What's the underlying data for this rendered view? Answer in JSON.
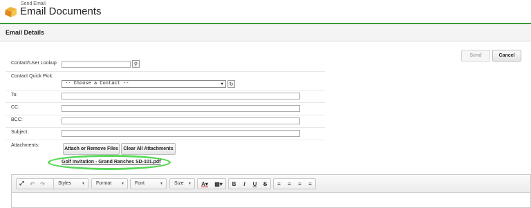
{
  "header": {
    "breadcrumb": "Send Email",
    "title": "Email Documents"
  },
  "section": {
    "title": "Email Details"
  },
  "actions": {
    "send_label": "Send",
    "cancel_label": "Cancel"
  },
  "form": {
    "lookup_label": "Contact/User Lookup",
    "quickpick_label": "Contact Quick Pick:",
    "quickpick_selected": "-- Choose a Contact --",
    "to_label": "To:",
    "cc_label": "CC:",
    "bcc_label": "BCC:",
    "subject_label": "Subject:",
    "attachments_label": "Attachments:",
    "attach_button": "Attach or Remove Files",
    "clear_button": "Clear All Attachments",
    "attachment_file": "Golf Invitation - Grand Ranches  SD-101.pdf"
  },
  "editor": {
    "styles_label": "Styles",
    "format_label": "Format",
    "font_label": "Font",
    "size_label": "Size"
  },
  "colors": {
    "accent_green": "#3a9a3a",
    "highlight_oval": "#58d858"
  }
}
